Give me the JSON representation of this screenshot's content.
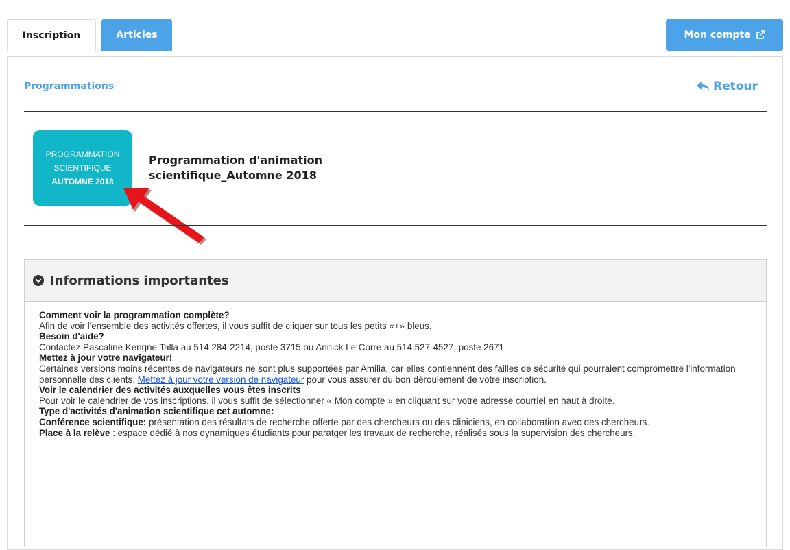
{
  "tabs": {
    "inscription": "Inscription",
    "articles": "Articles"
  },
  "account": {
    "label": "Mon compte",
    "icon": "external-link-icon"
  },
  "breadcrumb": {
    "label": "Programmations"
  },
  "back": {
    "label": "Retour",
    "icon": "reply-arrow-icon"
  },
  "program": {
    "logo": {
      "line1": "PROGRAMMATION",
      "line2": "SCIENTIFIQUE",
      "line3": "AUTOMNE 2018",
      "color": "#11b6c8"
    },
    "title": "Programmation d'animation scientifique_Automne 2018"
  },
  "info": {
    "title": "Informations importantes",
    "icon": "chevron-circle-down-icon",
    "h1": "Comment voir la programmation complète?",
    "p1": "Afin de voir l'ensemble des activités offertes, il vous suffit de cliquer sur tous  les petits «+» bleus.",
    "h2": "Besoin d'aide?",
    "p2": "Contactez Pascaline Kengne Talla au 514 284-2214, poste 3715 ou Annick Le Corre au 514 527-4527, poste 2671",
    "h3": "Mettez à jour votre navigateur!",
    "p3a": "Certaines versions moins récentes de navigateurs ne sont plus supportées par Amilia, car elles contiennent des failles de sécurité qui pourraient compromettre l'information personnelle des clients. ",
    "p3link": "Mettez à jour votre version de navigateur",
    "p3b": " pour vous assurer du bon déroulement de votre inscription.",
    "h4": "Voir le calendrier des activités auxquelles vous êtes inscrits",
    "p4": "Pour voir le calendrier de vos inscriptions, il vous suffit de sélectionner « Mon compte » en cliquant sur votre adresse courriel en haut à droite.",
    "h5": "Type d'activités d'animation scientifique cet automne:",
    "p5b": "Conférence scientifique:",
    "p5": "  présentation des résultats de recherche offerte par des chercheurs ou des cliniciens, en collaboration avec des chercheurs.",
    "p6b": "Place à la relève",
    "p6": " : espace dédié à nos dynamiques étudiants pour paratger les travaux de recherche, réalisés sous la supervision des chercheurs."
  },
  "colors": {
    "accent": "#4da3e8",
    "link": "#1a56d6",
    "annotation_arrow": "#e8141b"
  }
}
